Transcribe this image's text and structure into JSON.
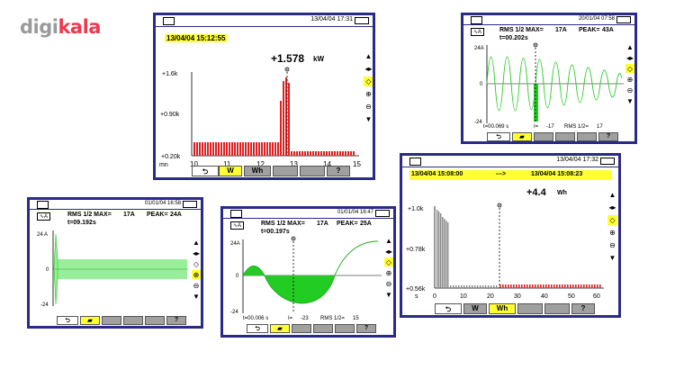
{
  "logo": {
    "part1": "digi",
    "part2": "kala"
  },
  "screens": {
    "energy": {
      "datetime": "13/04/04 17:31",
      "timestamp": "13/04/04 15:12:55",
      "value": "+1.578",
      "unit": "kW",
      "y_ticks": [
        "+1.6k",
        "+0.90k",
        "+0.20k"
      ],
      "x_unit": "mn",
      "x_ticks": [
        "10",
        "11",
        "12",
        "13",
        "14",
        "15"
      ],
      "tabs": [
        "W",
        "Wh",
        "?"
      ]
    },
    "inrush_top": {
      "datetime": "20/01/04 07:58",
      "rms_label": "RMS 1/2 MAX=",
      "rms_value": "17A",
      "peak_label": "PEAK=",
      "peak_value": "43A",
      "time": "t=00.202s",
      "y_ticks": [
        "24A",
        "0",
        "-24"
      ],
      "footer": [
        "t=00.069 s",
        "I=",
        "-17",
        "RMS 1/2=",
        "17"
      ],
      "tabs": [
        "?"
      ]
    },
    "energy_wh": {
      "datetime": "13/04/04 17:32",
      "range_start": "13/04/04 15:08:00",
      "range_arrow": "--->",
      "range_end": "13/04/04 15:08:23",
      "value": "+4.4",
      "unit": "Wh",
      "y_ticks": [
        "+1.0k",
        "+0.78k",
        "+0.56k"
      ],
      "x_unit": "s",
      "x_ticks": [
        "0",
        "10",
        "20",
        "30",
        "40",
        "50",
        "60"
      ],
      "tabs": [
        "W",
        "Wh",
        "?"
      ]
    },
    "inrush_left": {
      "datetime": "01/01/04 16:58",
      "rms_label": "RMS 1/2 MAX=",
      "rms_value": "17A",
      "peak_label": "PEAK=",
      "peak_value": "24A",
      "time": "t=09.192s",
      "y_ticks": [
        "24 A",
        "0",
        "-24"
      ],
      "tabs": [
        "?"
      ]
    },
    "inrush_mid": {
      "datetime": "01/01/04 16:47",
      "rms_label": "RMS 1/2 MAX=",
      "rms_value": "17A",
      "peak_label": "PEAK=",
      "peak_value": "25A",
      "time": "t=00.197s",
      "y_ticks": [
        "24A",
        "0",
        "-24"
      ],
      "footer": [
        "t=00.006 s",
        "I=",
        "-23",
        "RMS 1/2=",
        "15"
      ],
      "tabs": [
        "?"
      ]
    }
  },
  "colors": {
    "frame": "#2a2a88",
    "highlight": "#ffff33",
    "bar_red": "#dd2222",
    "wave_green": "#22cc22",
    "fill_green": "#99ee99"
  }
}
